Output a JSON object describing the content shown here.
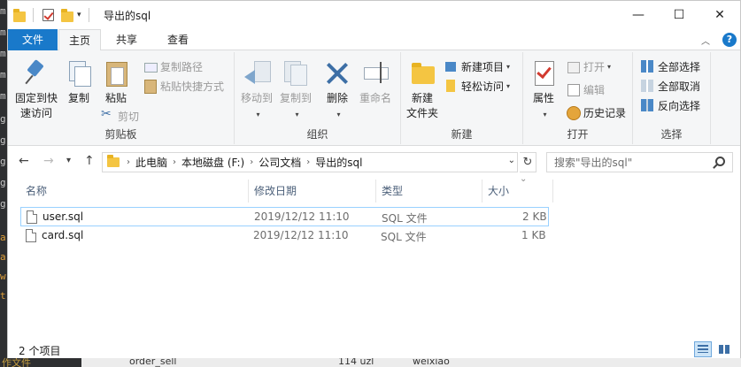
{
  "window": {
    "title": "导出的sql",
    "controls": {
      "minimize": "—",
      "maximize": "☐",
      "close": "✕"
    }
  },
  "ribbon_tabs": [
    {
      "label": "文件"
    },
    {
      "label": "主页"
    },
    {
      "label": "共享"
    },
    {
      "label": "查看"
    }
  ],
  "ribbon": {
    "clipboard": {
      "label": "剪贴板",
      "pin": "固定到快\n速访问",
      "pin_line1": "固定到快",
      "pin_line2": "速访问",
      "copy": "复制",
      "paste": "粘贴",
      "copy_path": "复制路径",
      "paste_shortcut": "粘贴快捷方式",
      "cut": "剪切"
    },
    "organize": {
      "label": "组织",
      "move_to": "移动到",
      "copy_to": "复制到",
      "delete": "删除",
      "rename": "重命名"
    },
    "new": {
      "label": "新建",
      "new_folder_line1": "新建",
      "new_folder_line2": "文件夹",
      "new_item": "新建项目",
      "easy_access": "轻松访问"
    },
    "open": {
      "label": "打开",
      "properties": "属性",
      "open": "打开",
      "edit": "编辑",
      "history": "历史记录"
    },
    "select": {
      "label": "选择",
      "select_all": "全部选择",
      "select_none": "全部取消",
      "invert": "反向选择"
    }
  },
  "address": {
    "breadcrumbs": [
      "此电脑",
      "本地磁盘 (F:)",
      "公司文档",
      "导出的sql"
    ],
    "search_placeholder": "搜索\"导出的sql\""
  },
  "columns": {
    "name": "名称",
    "modified": "修改日期",
    "type": "类型",
    "size": "大小"
  },
  "files": [
    {
      "name": "user.sql",
      "modified": "2019/12/12 11:10",
      "type": "SQL 文件",
      "size": "2 KB"
    },
    {
      "name": "card.sql",
      "modified": "2019/12/12 11:10",
      "type": "SQL 文件",
      "size": "1 KB"
    }
  ],
  "status": {
    "item_count": "2 个项目"
  },
  "background": {
    "left_chars": [
      "m",
      "m",
      "m",
      "m",
      "m",
      "g",
      "g",
      "g",
      "g",
      "g",
      "a",
      "a",
      "w",
      "t"
    ],
    "bottom_left": "作文件",
    "bottom_mid": "order_sell",
    "bottom_right1": "114 uzl",
    "bottom_right2": "weixiao"
  }
}
